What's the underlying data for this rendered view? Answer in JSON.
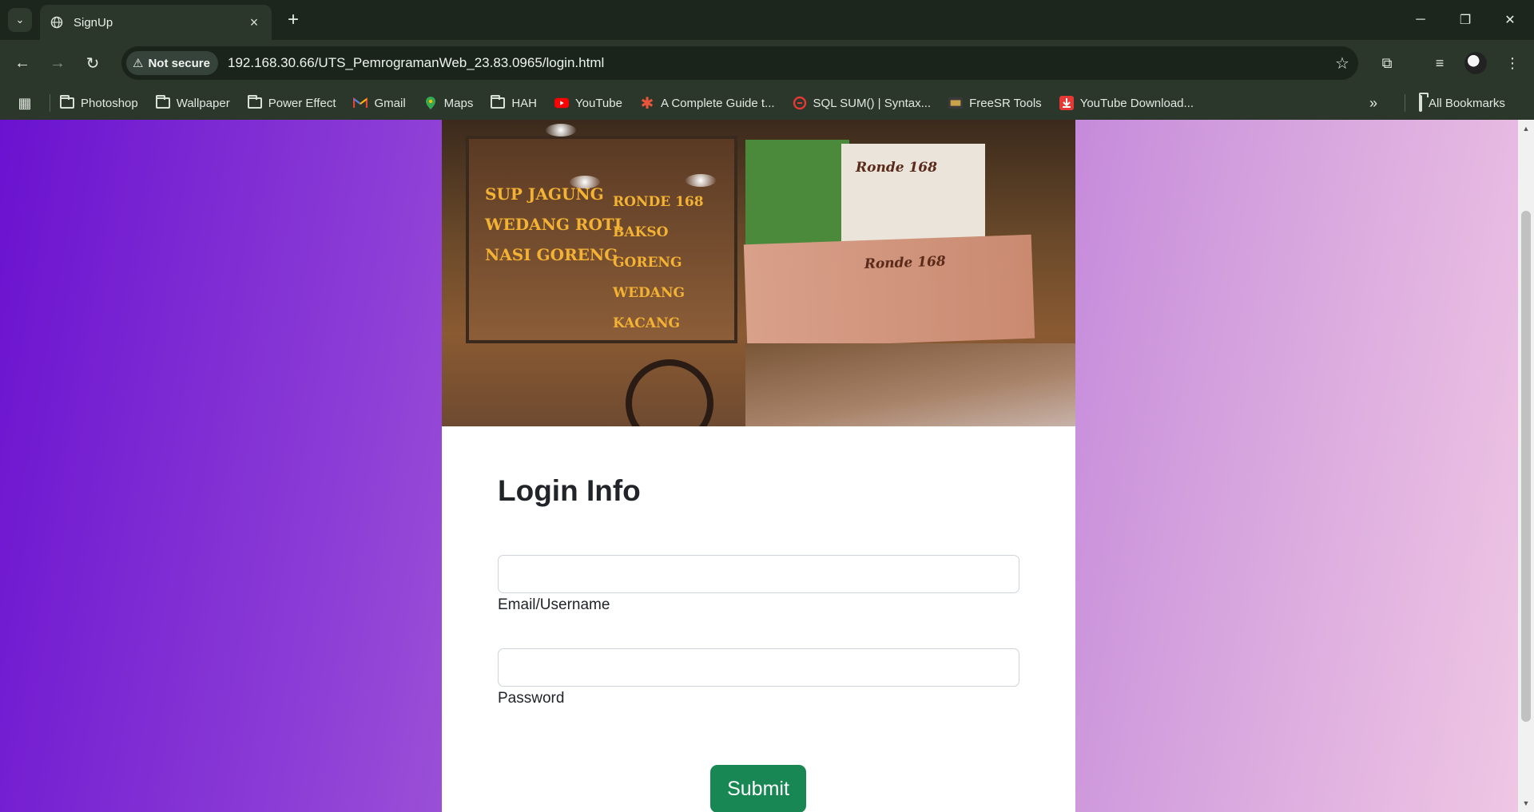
{
  "browser": {
    "tab_title": "SignUp",
    "security_label": "Not secure",
    "url": "192.168.30.66/UTS_PemrogramanWeb_23.83.0965/login.html",
    "bookmarks": [
      {
        "label": "Photoshop",
        "icon": "folder-icon"
      },
      {
        "label": "Wallpaper",
        "icon": "folder-icon"
      },
      {
        "label": "Power Effect",
        "icon": "folder-icon"
      },
      {
        "label": "Gmail",
        "icon": "gmail-icon"
      },
      {
        "label": "Maps",
        "icon": "maps-icon"
      },
      {
        "label": "HAH",
        "icon": "folder-icon"
      },
      {
        "label": "YouTube",
        "icon": "youtube-icon"
      },
      {
        "label": "A Complete Guide t...",
        "icon": "asterisk-icon"
      },
      {
        "label": "SQL SUM() | Syntax...",
        "icon": "sql-icon"
      },
      {
        "label": "FreeSR Tools",
        "icon": "freesr-icon"
      },
      {
        "label": "YouTube Download...",
        "icon": "download-icon"
      }
    ],
    "all_bookmarks": "All Bookmarks"
  },
  "hero": {
    "cart_lines": [
      "SUP JAGUNG",
      "WEDANG ROTI",
      "NASI GORENG"
    ],
    "cart_lines_right": [
      "RONDE 168",
      "BAKSO GORENG",
      "WEDANG KACANG"
    ],
    "banner_text": "Ronde 168"
  },
  "form": {
    "title": "Login Info",
    "email_label": "Email/Username",
    "email_value": "",
    "password_label": "Password",
    "password_value": "",
    "submit_label": "Submit"
  },
  "colors": {
    "accent_submit": "#198754",
    "gradient_start": "#6a12d0",
    "gradient_end": "#f0c8e4"
  }
}
